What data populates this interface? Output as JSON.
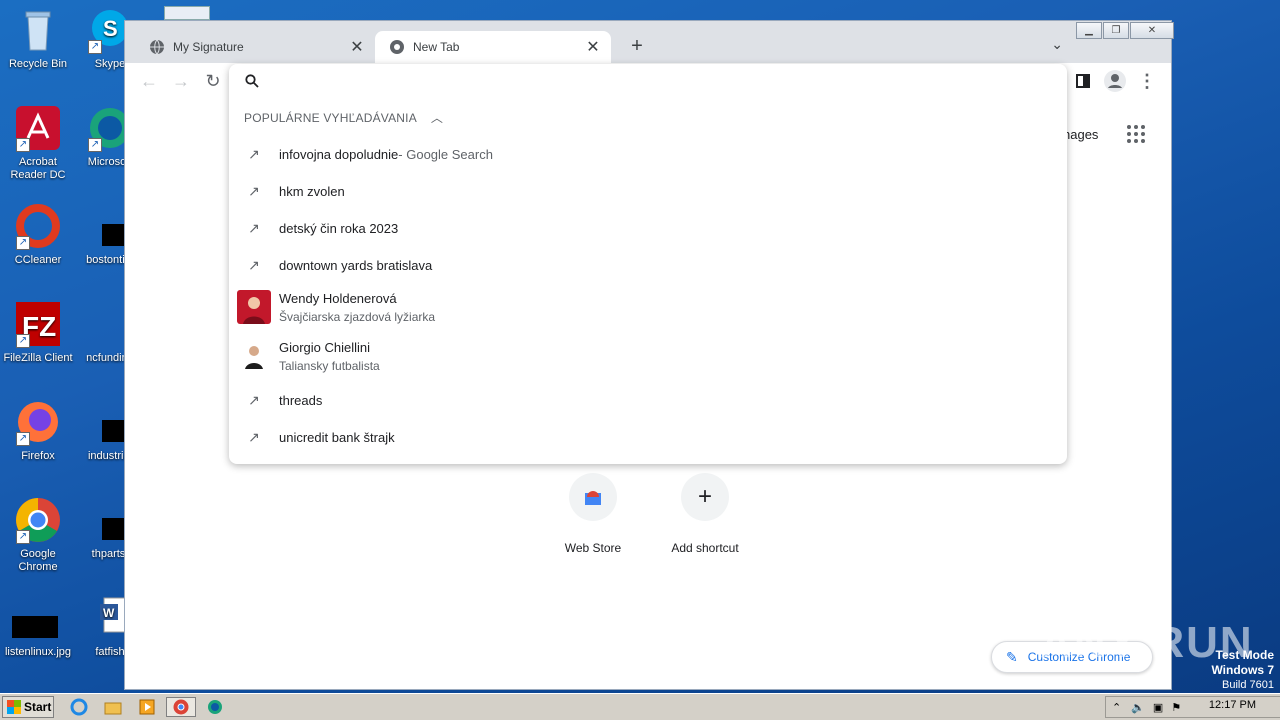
{
  "desktop": {
    "icons": [
      {
        "label": "Recycle Bin"
      },
      {
        "label": "Skype"
      },
      {
        "label": "Acrobat Reader DC"
      },
      {
        "label": "Microsoft"
      },
      {
        "label": "CCleaner"
      },
      {
        "label": "bostontim"
      },
      {
        "label": "FileZilla Client"
      },
      {
        "label": "ncfunding"
      },
      {
        "label": "Firefox"
      },
      {
        "label": "industrial"
      },
      {
        "label": "Google Chrome"
      },
      {
        "label": "thparts."
      },
      {
        "label": "listenlinux.jpg"
      },
      {
        "label": "fatfish"
      }
    ]
  },
  "browser": {
    "tabs": [
      {
        "title": "My Signature",
        "active": false
      },
      {
        "title": "New Tab",
        "active": true
      }
    ],
    "omnibox": {
      "value": ""
    },
    "dropdown": {
      "header": "POPULÁRNE VYHĽADÁVANIA",
      "suggestions": [
        {
          "text": "infovojna dopoludnie",
          "suffix": " - Google Search",
          "icon": "trending-icon"
        },
        {
          "text": "hkm zvolen",
          "icon": "trending-icon"
        },
        {
          "text": "detský čin roka 2023",
          "icon": "trending-icon"
        },
        {
          "text": "downtown yards bratislava",
          "icon": "trending-icon"
        },
        {
          "text": "Wendy Holdenerová",
          "sub": "Švajčiarska zjazdová lyžiarka",
          "icon": "thumbnail"
        },
        {
          "text": "Giorgio Chiellini",
          "sub": "Taliansky futbalista",
          "icon": "thumbnail"
        },
        {
          "text": "threads",
          "icon": "trending-icon"
        },
        {
          "text": "unicredit bank štrajk",
          "icon": "trending-icon"
        }
      ]
    },
    "ntp": {
      "images_link": "Images",
      "images_link_visible": "nages",
      "shortcuts": [
        {
          "label": "Web Store"
        },
        {
          "label": "Add shortcut"
        }
      ],
      "customize_label": "Customize Chrome"
    }
  },
  "watermark": {
    "text": "ANY RUN"
  },
  "os_notice": {
    "line1": "Test Mode",
    "line2": "Windows 7",
    "line3": "Build 7601"
  },
  "taskbar": {
    "start_label": "Start",
    "clock": "12:17 PM"
  }
}
